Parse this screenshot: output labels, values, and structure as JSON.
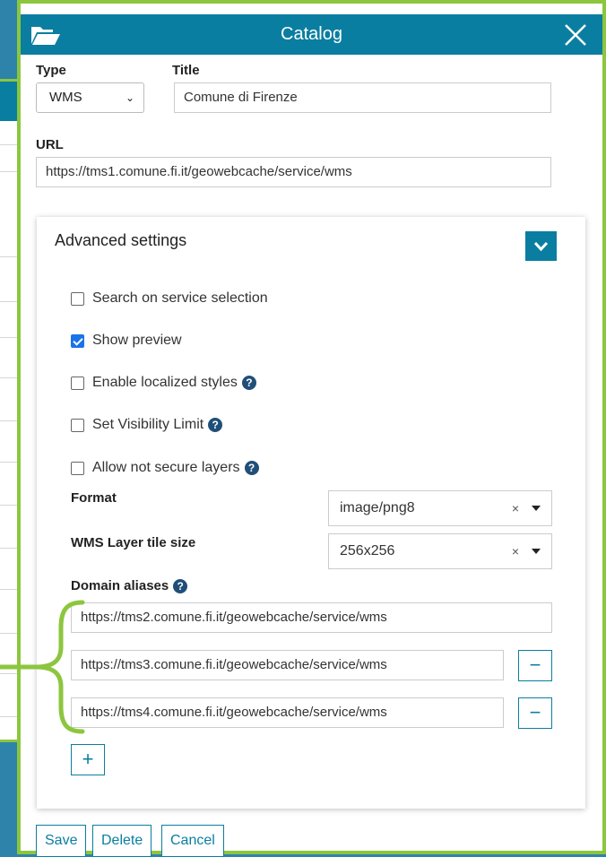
{
  "dialog": {
    "title": "Catalog",
    "folder_icon": "folder-open-icon",
    "close_icon": "close-icon"
  },
  "form": {
    "type_label": "Type",
    "type_value": "WMS",
    "title_label": "Title",
    "title_value": "Comune di Firenze",
    "url_label": "URL",
    "url_value": "https://tms1.comune.fi.it/geowebcache/service/wms"
  },
  "advanced": {
    "title": "Advanced settings",
    "options": [
      {
        "label": "Search on service selection",
        "checked": false,
        "help": false
      },
      {
        "label": "Show preview",
        "checked": true,
        "help": false
      },
      {
        "label": "Enable localized styles",
        "checked": false,
        "help": true
      },
      {
        "label": "Set Visibility Limit",
        "checked": false,
        "help": true
      },
      {
        "label": "Allow not secure layers",
        "checked": false,
        "help": true
      }
    ],
    "format_label": "Format",
    "format_value": "image/png8",
    "tile_label": "WMS Layer tile size",
    "tile_value": "256x256",
    "clear_symbol": "×",
    "aliases_label": "Domain aliases",
    "aliases": [
      "https://tms2.comune.fi.it/geowebcache/service/wms",
      "https://tms3.comune.fi.it/geowebcache/service/wms",
      "https://tms4.comune.fi.it/geowebcache/service/wms"
    ],
    "remove_symbol": "−",
    "add_symbol": "+"
  },
  "buttons": {
    "save": "Save",
    "delete": "Delete",
    "cancel": "Cancel"
  },
  "colors": {
    "accent": "#0a7ea0",
    "highlight": "#8cc63f",
    "help": "#1f4f79",
    "checkbox": "#1a73e8"
  }
}
